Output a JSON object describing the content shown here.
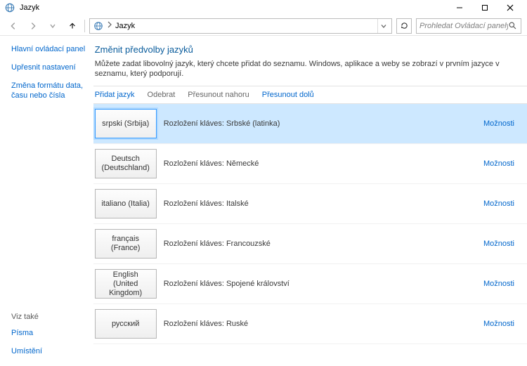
{
  "window": {
    "title": "Jazyk"
  },
  "address": {
    "crumb": "Jazyk"
  },
  "search": {
    "placeholder": "Prohledat Ovládací panely"
  },
  "sidebar": {
    "home": "Hlavní ovládací panel",
    "advanced": "Upřesnit nastavení",
    "datefmt": "Změna formátu data, času nebo čísla",
    "see_also_label": "Viz také",
    "fonts": "Písma",
    "location": "Umístění"
  },
  "main": {
    "heading": "Změnit předvolby jazyků",
    "description": "Můžete zadat libovolný jazyk, který chcete přidat do seznamu. Windows, aplikace a weby se zobrazí v prvním jazyce v seznamu, který podporují."
  },
  "toolbar": {
    "add": "Přidat jazyk",
    "remove": "Odebrat",
    "move_up": "Přesunout nahoru",
    "move_down": "Přesunout dolů"
  },
  "options_label": "Možnosti",
  "languages": [
    {
      "name": "srpski (Srbija)",
      "layout": "Rozložení kláves: Srbské (latinka)",
      "selected": true
    },
    {
      "name": "Deutsch (Deutschland)",
      "layout": "Rozložení kláves: Německé",
      "selected": false
    },
    {
      "name": "italiano (Italia)",
      "layout": "Rozložení kláves: Italské",
      "selected": false
    },
    {
      "name": "français (France)",
      "layout": "Rozložení kláves: Francouzské",
      "selected": false
    },
    {
      "name": "English (United Kingdom)",
      "layout": "Rozložení kláves: Spojené království",
      "selected": false
    },
    {
      "name": "русский",
      "layout": "Rozložení kláves: Ruské",
      "selected": false
    }
  ]
}
